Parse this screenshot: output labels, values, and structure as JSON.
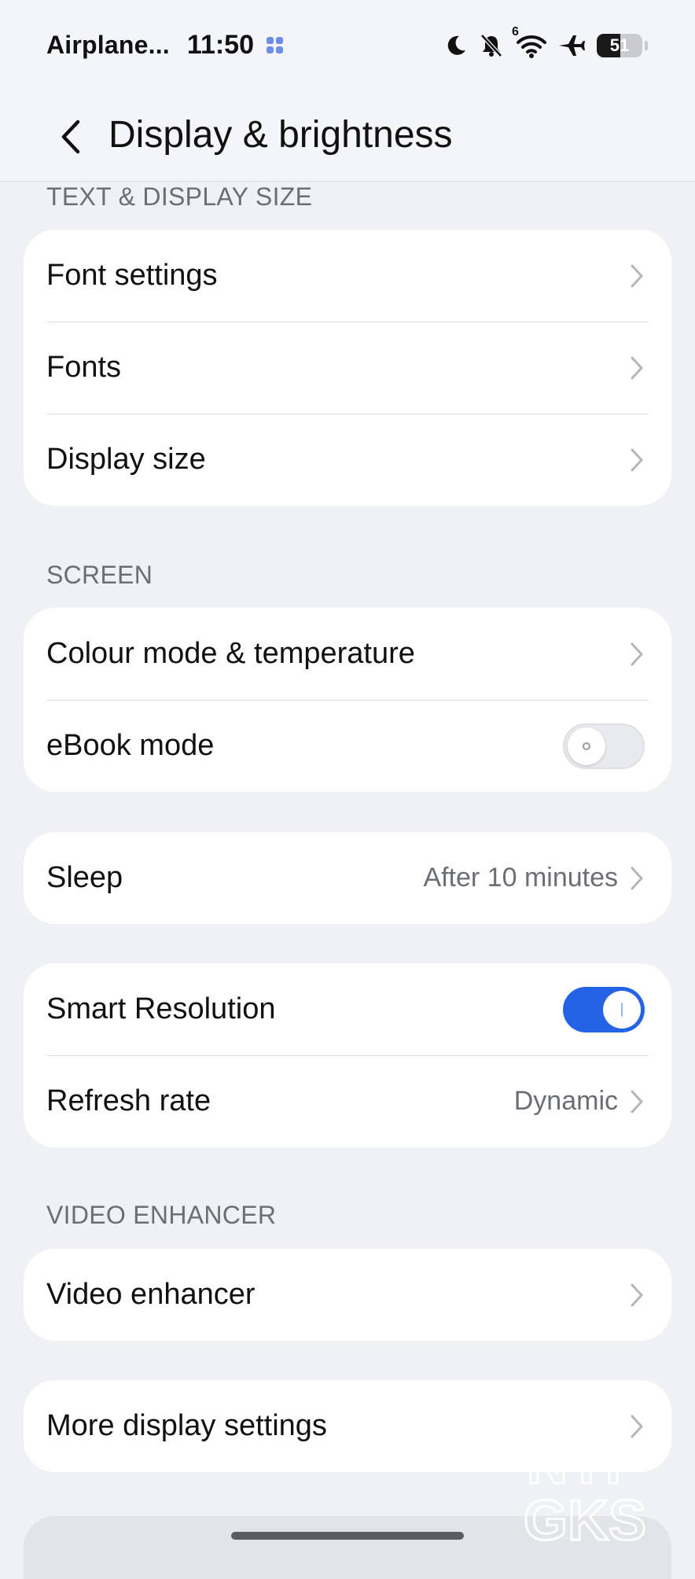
{
  "status_bar": {
    "mode_label": "Airplane...",
    "time": "11:50",
    "icons": [
      "app-grid-icon",
      "moon-icon",
      "bell-off-icon",
      "wifi-icon",
      "airplane-icon",
      "battery-icon"
    ],
    "wifi_badge": "6",
    "battery_percent": "51",
    "battery_level": 0.51
  },
  "header": {
    "title": "Display & brightness",
    "back_icon": "chevron-left-icon"
  },
  "sections": {
    "text_display": {
      "label": "TEXT & DISPLAY SIZE",
      "items": [
        {
          "label": "Font settings"
        },
        {
          "label": "Fonts"
        },
        {
          "label": "Display size"
        }
      ]
    },
    "screen": {
      "label": "SCREEN",
      "items": [
        {
          "label": "Colour mode & temperature"
        },
        {
          "label": "eBook mode",
          "toggle": false
        }
      ]
    },
    "sleep": {
      "label": "Sleep",
      "value": "After 10 minutes"
    },
    "resolution": {
      "items": [
        {
          "label": "Smart Resolution",
          "toggle": true
        },
        {
          "label": "Refresh rate",
          "value": "Dynamic"
        }
      ]
    },
    "video": {
      "label": "VIDEO ENHANCER",
      "items": [
        {
          "label": "Video enhancer"
        }
      ]
    },
    "more": {
      "label": "More display settings"
    }
  },
  "watermark": {
    "line1": "NYP",
    "line2": "GKS"
  },
  "colors": {
    "accent": "#2463e6",
    "background": "#eff1f5",
    "card": "#ffffff",
    "secondary_text": "#6b6e74"
  }
}
